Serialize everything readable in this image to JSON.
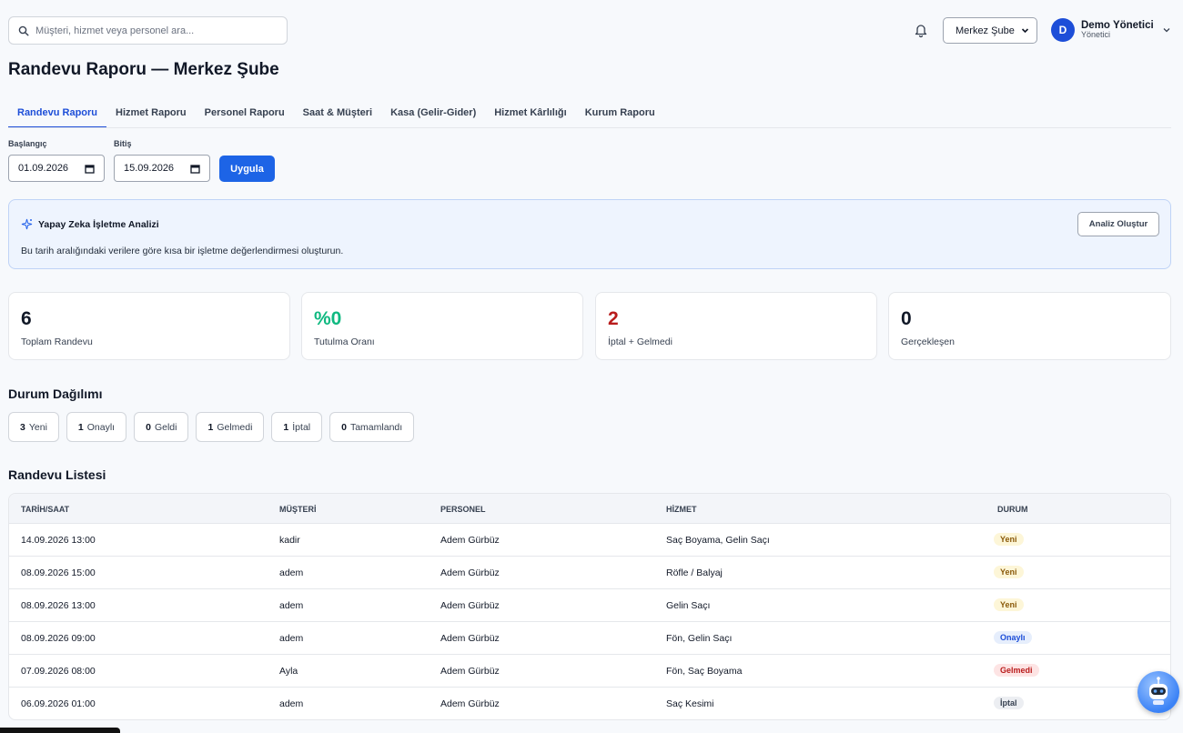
{
  "search": {
    "placeholder": "Müşteri, hizmet veya personel ara..."
  },
  "header": {
    "branch": "Merkez Şube",
    "user": {
      "initial": "D",
      "name": "Demo Yönetici",
      "role": "Yönetici"
    }
  },
  "page": {
    "title": "Randevu Raporu — Merkez Şube"
  },
  "tabs": [
    {
      "label": "Randevu Raporu",
      "active": true
    },
    {
      "label": "Hizmet Raporu"
    },
    {
      "label": "Personel Raporu"
    },
    {
      "label": "Saat & Müşteri"
    },
    {
      "label": "Kasa (Gelir-Gider)"
    },
    {
      "label": "Hizmet Kârlılığı"
    },
    {
      "label": "Kurum Raporu"
    }
  ],
  "filters": {
    "start_label": "Başlangıç",
    "start_value": "01.09.2026",
    "end_label": "Bitiş",
    "end_value": "15.09.2026",
    "apply": "Uygula"
  },
  "ai": {
    "title": "Yapay Zeka İşletme Analizi",
    "desc": "Bu tarih aralığındaki verilere göre kısa bir işletme değerlendirmesi oluşturun.",
    "button": "Analiz Oluştur"
  },
  "stats": [
    {
      "value": "6",
      "label": "Toplam Randevu",
      "color": "#111827"
    },
    {
      "value": "%0",
      "label": "Tutulma Oranı",
      "color": "#10b981"
    },
    {
      "value": "2",
      "label": "İptal + Gelmedi",
      "color": "#b91c1c"
    },
    {
      "value": "0",
      "label": "Gerçekleşen",
      "color": "#111827"
    }
  ],
  "status_section": {
    "title": "Durum Dağılımı",
    "chips": [
      {
        "count": "3",
        "label": "Yeni"
      },
      {
        "count": "1",
        "label": "Onaylı"
      },
      {
        "count": "0",
        "label": "Geldi"
      },
      {
        "count": "1",
        "label": "Gelmedi"
      },
      {
        "count": "1",
        "label": "İptal"
      },
      {
        "count": "0",
        "label": "Tamamlandı"
      }
    ]
  },
  "list": {
    "title": "Randevu Listesi",
    "headers": [
      "TARİH/SAAT",
      "MÜŞTERİ",
      "PERSONEL",
      "HİZMET",
      "DURUM"
    ],
    "rows": [
      {
        "datetime": "14.09.2026 13:00",
        "customer": "kadir",
        "staff": "Adem Gürbüz",
        "service": "Saç Boyama, Gelin Saçı",
        "status": "Yeni",
        "kind": "new"
      },
      {
        "datetime": "08.09.2026 15:00",
        "customer": "adem",
        "staff": "Adem Gürbüz",
        "service": "Röfle / Balyaj",
        "status": "Yeni",
        "kind": "new"
      },
      {
        "datetime": "08.09.2026 13:00",
        "customer": "adem",
        "staff": "Adem Gürbüz",
        "service": "Gelin Saçı",
        "status": "Yeni",
        "kind": "new"
      },
      {
        "datetime": "08.09.2026 09:00",
        "customer": "adem",
        "staff": "Adem Gürbüz",
        "service": "Fön, Gelin Saçı",
        "status": "Onaylı",
        "kind": "ok"
      },
      {
        "datetime": "07.09.2026 08:00",
        "customer": "Ayla",
        "staff": "Adem Gürbüz",
        "service": "Fön, Saç Boyama",
        "status": "Gelmedi",
        "kind": "noshow"
      },
      {
        "datetime": "06.09.2026 01:00",
        "customer": "adem",
        "staff": "Adem Gürbüz",
        "service": "Saç Kesimi",
        "status": "İptal",
        "kind": "cancel"
      }
    ]
  },
  "icons": {
    "search": "search-icon",
    "bell": "bell-icon",
    "calendar": "calendar-icon",
    "sparkle": "sparkle-icon",
    "chevron": "chevron-down-icon",
    "assistant": "robot-assistant-icon"
  },
  "colors": {
    "accent": "#1d64e6",
    "ai_bg": "#eef4fe",
    "success": "#10b981",
    "danger": "#b91c1c"
  }
}
